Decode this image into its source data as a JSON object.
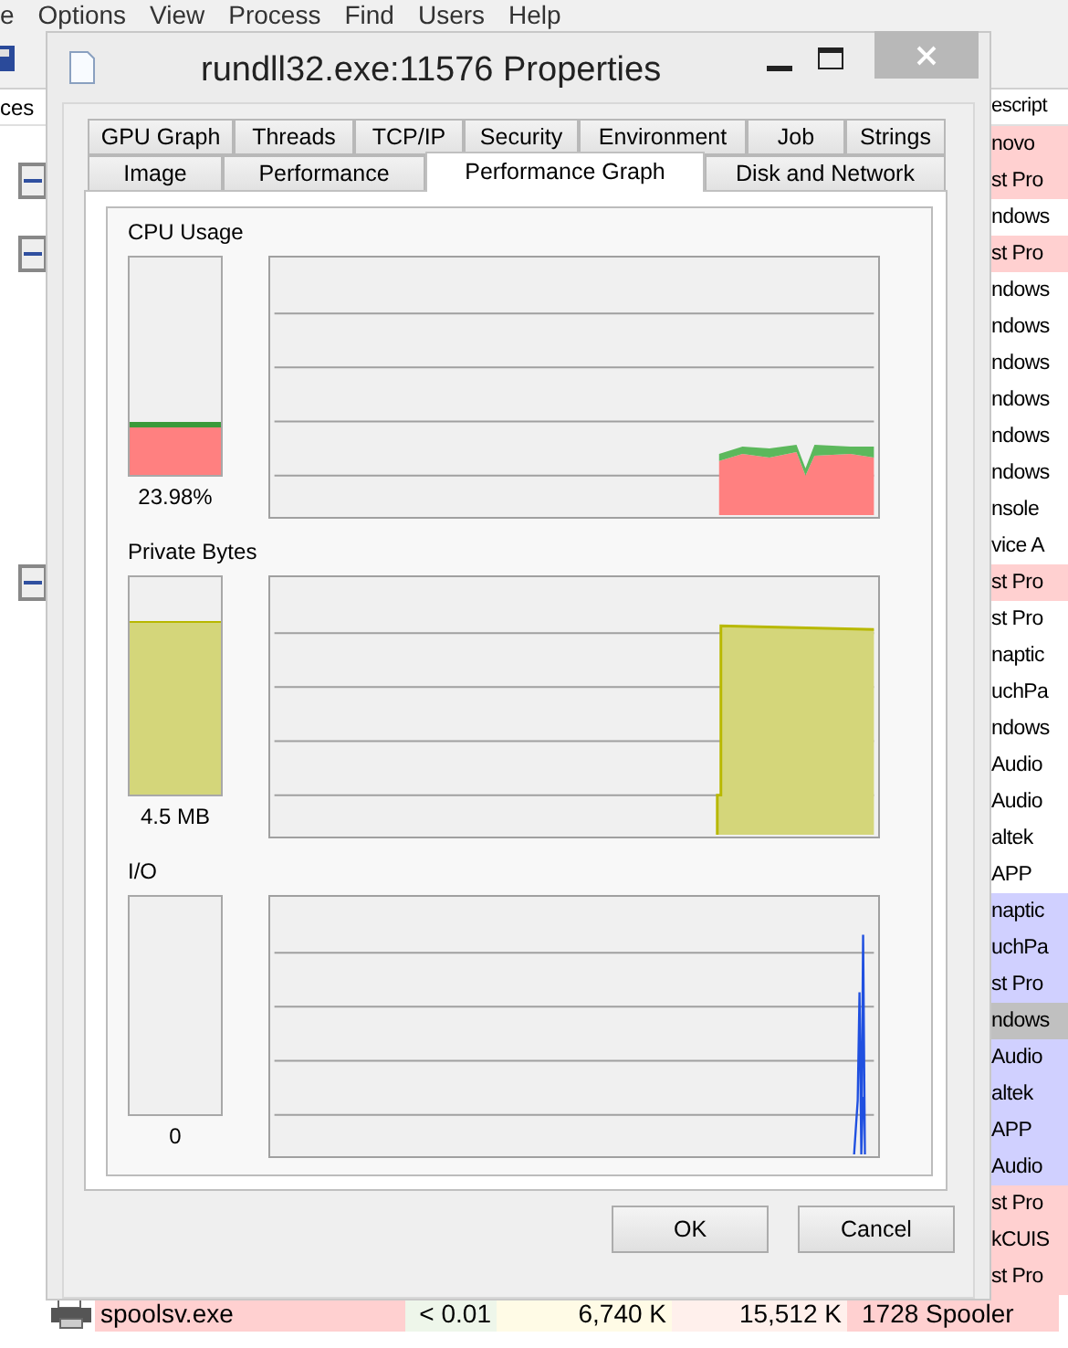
{
  "main_window": {
    "menu": [
      "e",
      "Options",
      "View",
      "Process",
      "Find",
      "Users",
      "Help"
    ],
    "column_headers": {
      "column_1": "ces",
      "column_2": "escript"
    },
    "rows": [
      {
        "description": "novo",
        "color": "#ffd0d0"
      },
      {
        "description": "st Pro",
        "color": "#ffd0d0",
        "toggle": {
          "expanded": true
        }
      },
      {
        "description": "ndows",
        "color": "#ffffff"
      },
      {
        "description": "st Pro",
        "color": "#ffd0d0",
        "toggle": {
          "expanded": true
        }
      },
      {
        "description": "ndows",
        "color": "#ffffff"
      },
      {
        "description": "ndows",
        "color": "#ffffff"
      },
      {
        "description": "ndows",
        "color": "#ffffff"
      },
      {
        "description": "ndows",
        "color": "#ffffff"
      },
      {
        "description": "ndows",
        "color": "#ffffff"
      },
      {
        "description": "ndows",
        "color": "#ffffff"
      },
      {
        "description": "nsole",
        "color": "#ffffff"
      },
      {
        "description": "vice A",
        "color": "#ffffff"
      },
      {
        "description": "st Pro",
        "color": "#ffd0d0",
        "toggle": {
          "expanded": true
        }
      },
      {
        "description": "st Pro",
        "color": "#ffffff"
      },
      {
        "description": "naptic",
        "color": "#ffffff"
      },
      {
        "description": "uchPa",
        "color": "#ffffff"
      },
      {
        "description": "ndows",
        "color": "#ffffff"
      },
      {
        "description": "Audio",
        "color": "#ffffff"
      },
      {
        "description": "Audio",
        "color": "#ffffff"
      },
      {
        "description": "altek",
        "color": "#ffffff"
      },
      {
        "description": "APP",
        "color": "#ffffff"
      },
      {
        "description": "naptic",
        "color": "#d0d0ff"
      },
      {
        "description": "uchPa",
        "color": "#d0d0ff"
      },
      {
        "description": "st Pro",
        "color": "#d0d0ff"
      },
      {
        "description": "ndows",
        "color": "#c0c0c0"
      },
      {
        "description": "Audio",
        "color": "#d0d0ff"
      },
      {
        "description": "altek",
        "color": "#d0d0ff"
      },
      {
        "description": "APP",
        "color": "#d0d0ff"
      },
      {
        "description": "Audio",
        "color": "#d0d0ff"
      },
      {
        "description": "st Pro",
        "color": "#ffd0d0"
      },
      {
        "description": "kCUIS",
        "color": "#ffd0d0"
      },
      {
        "description": "st Pro",
        "color": "#ffd0d0"
      }
    ],
    "process_row": {
      "cells": [
        {
          "text": "spoolsv.exe",
          "color": "#ffd0d0"
        },
        {
          "text": "< 0.01",
          "color": "#eef6ea"
        },
        {
          "text": "6,740 K",
          "color": "#fffbe6"
        },
        {
          "text": "15,512 K",
          "color": "#fff0ec"
        },
        {
          "text": "1728 Spooler",
          "color": "#ffd0d0"
        }
      ]
    }
  },
  "dialog": {
    "title": "rundll32.exe:11576 Properties",
    "tab_rows": [
      [
        {
          "label": "GPU Graph",
          "selected": false
        },
        {
          "label": "Threads",
          "selected": false
        },
        {
          "label": "TCP/IP",
          "selected": false
        },
        {
          "label": "Security",
          "selected": false
        },
        {
          "label": "Environment",
          "selected": false
        },
        {
          "label": "Job",
          "selected": false
        },
        {
          "label": "Strings",
          "selected": false
        }
      ],
      [
        {
          "label": "Image",
          "selected": false
        },
        {
          "label": "Performance",
          "selected": false
        },
        {
          "label": "Performance Graph",
          "selected": true
        },
        {
          "label": "Disk and Network",
          "selected": false
        }
      ]
    ],
    "graphs": [
      {
        "kind": "cpu",
        "label": "CPU Usage",
        "level": 0.24,
        "reading": "23.98%"
      },
      {
        "kind": "memory",
        "label": "Private Bytes",
        "level": 0.8,
        "reading": "4.5 MB"
      },
      {
        "kind": "io",
        "label": "I/O",
        "level": 0,
        "reading": "0"
      }
    ],
    "buttons": [
      "OK",
      "Cancel"
    ]
  }
}
